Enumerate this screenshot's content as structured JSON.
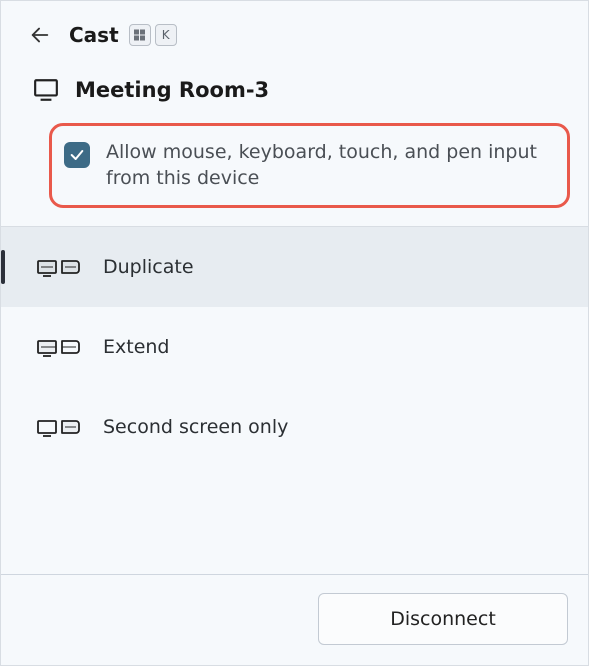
{
  "header": {
    "title": "Cast",
    "shortcut_keys": [
      "Win",
      "K"
    ]
  },
  "device": {
    "name": "Meeting Room-3"
  },
  "input_option": {
    "checked": true,
    "label": "Allow mouse, keyboard, touch, and pen input from this device"
  },
  "modes": [
    {
      "id": "duplicate",
      "label": "Duplicate",
      "selected": true
    },
    {
      "id": "extend",
      "label": "Extend",
      "selected": false
    },
    {
      "id": "second-only",
      "label": "Second screen only",
      "selected": false
    }
  ],
  "footer": {
    "disconnect_label": "Disconnect"
  },
  "colors": {
    "highlight_border": "#e9594b",
    "checkbox_bg": "#3d6b86",
    "selected_bg": "#e7ecf1"
  }
}
